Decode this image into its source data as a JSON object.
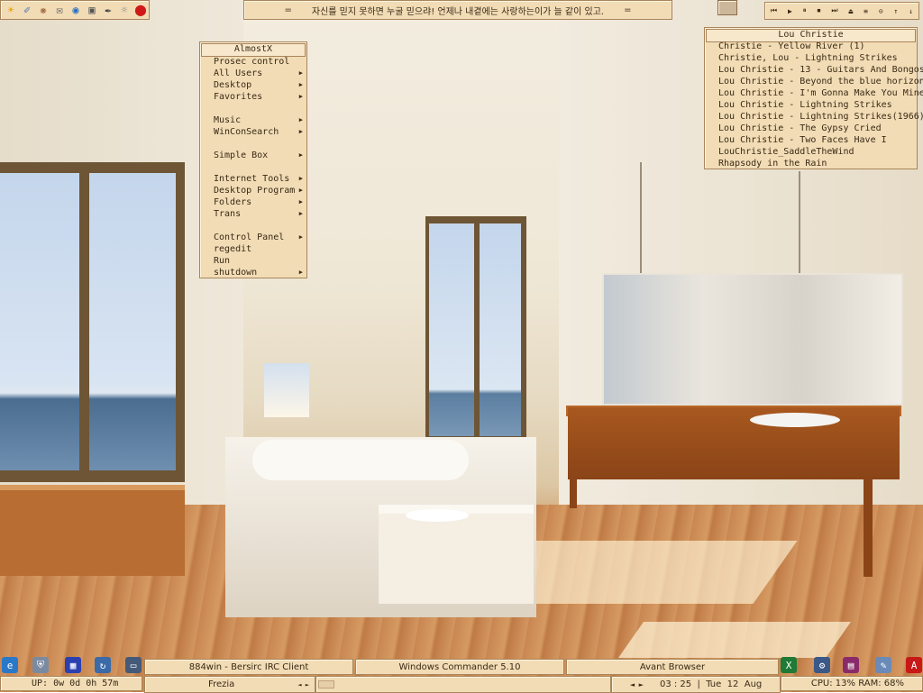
{
  "launcher": {
    "icons": [
      "sun-icon",
      "feather-icon",
      "bug-icon",
      "mail-icon",
      "globe-icon",
      "printer-icon",
      "pen-icon",
      "bulb-icon",
      "power-icon"
    ]
  },
  "ticker": {
    "left_mark": "=",
    "text": "자신를 믿지 못하면 누굴 믿으랴!  언제나 내곁에는 사랑하는이가 늘 같이 있고.",
    "right_mark": "="
  },
  "media": {
    "buttons": [
      "⏮",
      "▶",
      "⏸",
      "⏹",
      "⏭",
      "⏏",
      "≡",
      "⊙",
      "↑",
      "↓"
    ]
  },
  "menu": {
    "title": "AlmostX",
    "items": [
      {
        "label": "Prosec control",
        "submenu": false
      },
      {
        "label": "All Users",
        "submenu": true
      },
      {
        "label": "Desktop",
        "submenu": true
      },
      {
        "label": "Favorites",
        "submenu": true
      },
      {
        "label": "Music",
        "submenu": true
      },
      {
        "label": "WinConSearch",
        "submenu": true
      },
      {
        "label": "Simple Box",
        "submenu": true
      },
      {
        "label": "Internet Tools",
        "submenu": true
      },
      {
        "label": "Desktop Program",
        "submenu": true
      },
      {
        "label": "Folders",
        "submenu": true
      },
      {
        "label": "Trans",
        "submenu": true
      },
      {
        "label": "Control Panel",
        "submenu": true
      },
      {
        "label": "regedit",
        "submenu": false
      },
      {
        "label": "Run",
        "submenu": false
      },
      {
        "label": "shutdown",
        "submenu": true
      }
    ],
    "arrow": "▶"
  },
  "playlist": {
    "title": "Lou Christie",
    "items": [
      "Christie - Yellow River (1)",
      "Christie, Lou - Lightning Strikes",
      "Lou Christie - 13 - Guitars And Bongos",
      "Lou Christie - Beyond the blue horizon",
      "Lou Christie - I'm Gonna Make You Mine",
      "Lou Christie - Lightning Strikes",
      "Lou Christie - Lightning Strikes(1966)",
      "Lou Christie - The Gypsy Cried",
      "Lou Christie - Two Faces Have I",
      "LouChristie_SaddleTheWind",
      "Rhapsody in the Rain"
    ]
  },
  "taskbar": {
    "left_icons": [
      "ie-icon",
      "shield-icon",
      "floppy-icon",
      "network-icon",
      "monitor-icon"
    ],
    "tasks": [
      "884win - Bersirc IRC Client",
      "Windows Commander 5.10",
      "Avant Browser"
    ],
    "right_icons": [
      "excel-icon",
      "media-icon",
      "winrar-icon",
      "notepad-icon",
      "acrobat-icon"
    ]
  },
  "status": {
    "uptime": "UP: 0w 0d 0h 57m",
    "now_playing": "Frezia",
    "np_arrows": "◄  ►",
    "seek_progress": 0.05,
    "clock_arrows": "◄  ►",
    "clock": "03 : 25  |  Tue  12  Aug",
    "cpu": "CPU: 13%  RAM: 68%"
  },
  "colors": {
    "panel_bg": "#f1dcb6",
    "panel_border": "#a9855a",
    "text": "#3a2a14"
  }
}
